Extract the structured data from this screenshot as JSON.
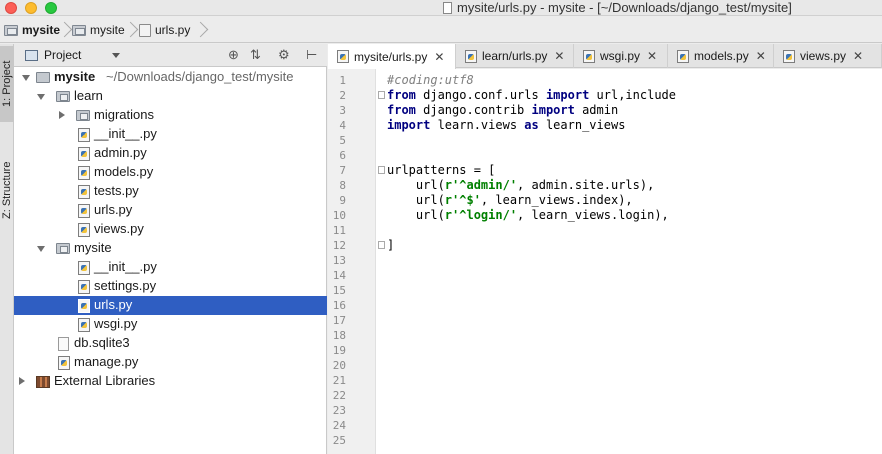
{
  "window": {
    "title": "mysite/urls.py - mysite - [~/Downloads/django_test/mysite]"
  },
  "breadcrumbs": [
    "mysite",
    "mysite",
    "urls.py"
  ],
  "toolstrip": {
    "project_tab": "1: Project",
    "structure_tab": "Z: Structure"
  },
  "project_panel": {
    "title": "Project",
    "toolbar_icons": [
      "target-icon",
      "collapse-icon",
      "gear-icon",
      "hide-icon"
    ]
  },
  "tree": [
    {
      "label": "mysite",
      "path": "~/Downloads/django_test/mysite",
      "type": "folder",
      "expanded": true,
      "bold": true
    },
    {
      "label": "learn",
      "type": "package",
      "expanded": true
    },
    {
      "label": "migrations",
      "type": "package",
      "expanded": false
    },
    {
      "label": "__init__.py",
      "type": "py"
    },
    {
      "label": "admin.py",
      "type": "py"
    },
    {
      "label": "models.py",
      "type": "py"
    },
    {
      "label": "tests.py",
      "type": "py"
    },
    {
      "label": "urls.py",
      "type": "py"
    },
    {
      "label": "views.py",
      "type": "py"
    },
    {
      "label": "mysite",
      "type": "package",
      "expanded": true
    },
    {
      "label": "__init__.py",
      "type": "py"
    },
    {
      "label": "settings.py",
      "type": "py"
    },
    {
      "label": "urls.py",
      "type": "py",
      "selected": true
    },
    {
      "label": "wsgi.py",
      "type": "py"
    },
    {
      "label": "db.sqlite3",
      "type": "file"
    },
    {
      "label": "manage.py",
      "type": "py"
    },
    {
      "label": "External Libraries",
      "type": "library",
      "expanded": false
    }
  ],
  "tabs": [
    {
      "label": "mysite/urls.py",
      "active": true
    },
    {
      "label": "learn/urls.py"
    },
    {
      "label": "wsgi.py"
    },
    {
      "label": "models.py"
    },
    {
      "label": "views.py"
    }
  ],
  "editor": {
    "line_numbers": [
      "1",
      "2",
      "3",
      "4",
      "5",
      "6",
      "7",
      "8",
      "9",
      "10",
      "11",
      "12",
      "13",
      "14",
      "15",
      "16",
      "17",
      "18",
      "19",
      "20",
      "21",
      "22",
      "23",
      "24",
      "25"
    ],
    "code": {
      "l1_comment": "#coding:utf8",
      "l2_from": "from",
      "l2_mod": " django.conf.urls ",
      "l2_import": "import",
      "l2_rest": " url,include",
      "l3_from": "from",
      "l3_mod": " django.contrib ",
      "l3_import": "import",
      "l3_rest": " admin",
      "l4_import": "import",
      "l4_mod": " learn.views ",
      "l4_as": "as",
      "l4_rest": " learn_views",
      "l7": "urlpatterns = [",
      "l8_pre": "    url(",
      "l8_str": "r'^admin/'",
      "l8_post": ", admin.site.urls),",
      "l9_pre": "    url(",
      "l9_str": "r'^$'",
      "l9_post": ", learn_views.index),",
      "l10_pre": "    url(",
      "l10_str": "r'^login/'",
      "l10_post": ", learn_views.login),",
      "l12": "]"
    }
  },
  "colors": {
    "selection": "#2f5ec2",
    "keyword": "#000080",
    "string": "#008000",
    "comment": "#808080"
  }
}
